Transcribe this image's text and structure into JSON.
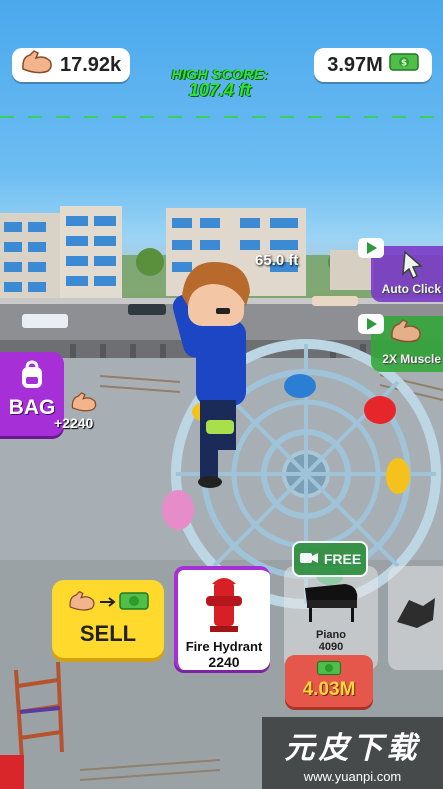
{
  "hud": {
    "muscle_value": "17.92k",
    "money_value": "3.97M",
    "high_score_label": "HIGH SCORE:",
    "high_score_value": "107.4 ft"
  },
  "player": {
    "height_label": "65.0 ft"
  },
  "bag": {
    "label": "BAG",
    "gain": "+2240"
  },
  "side_buttons": [
    {
      "label": "Auto Click"
    },
    {
      "label": "2X Muscle"
    }
  ],
  "sell_button": {
    "label": "SELL"
  },
  "items": [
    {
      "name": "Fire Hydrant",
      "cost": "2240",
      "icon": "fire-hydrant-icon",
      "state": "selected"
    },
    {
      "name": "Piano",
      "cost": "4090",
      "icon": "piano-icon",
      "state": "available"
    },
    {
      "name": "",
      "cost": "",
      "icon": "locked-item-icon",
      "state": "locked"
    }
  ],
  "free_button": {
    "label": "FREE"
  },
  "upgrade_price": {
    "value": "4.03M"
  },
  "watermark": {
    "title": "元皮下载",
    "url": "www.yuanpi.com"
  },
  "colors": {
    "bag": "#a62fd8",
    "sell": "#ffd92c",
    "price": "#e4574a",
    "high_score": "#2ae43c"
  }
}
